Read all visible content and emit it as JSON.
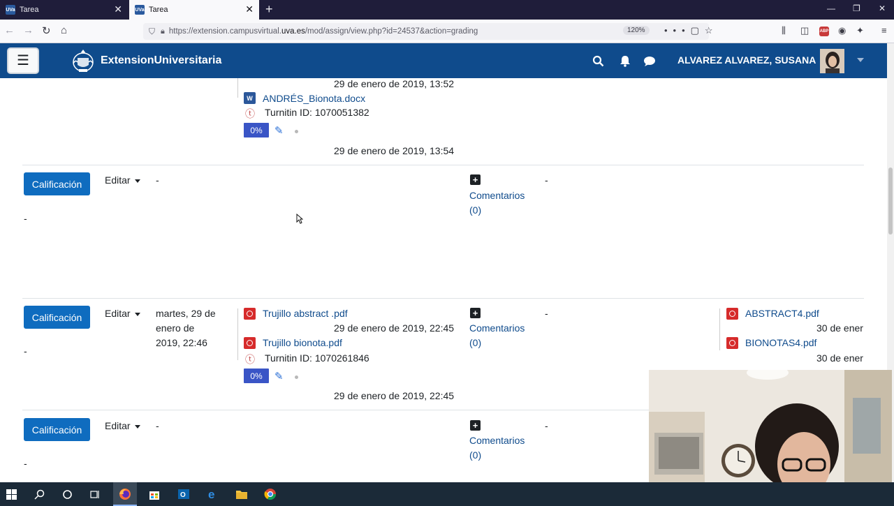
{
  "browser": {
    "tabs": [
      {
        "favicon": "UVa",
        "label": "Tarea",
        "close": "✕"
      },
      {
        "favicon": "UVa",
        "label": "Tarea",
        "close": "✕"
      }
    ],
    "new_tab": "+",
    "url_prefix": "https://extension.campusvirtual.",
    "url_domain": "uva.es",
    "url_suffix": "/mod/assign/view.php?id=24537&action=grading",
    "zoom": "120%",
    "abp_label": "ABP"
  },
  "moodle": {
    "brand": "ExtensionUniversitaria",
    "user": "ALVAREZ ALVAREZ, SUSANA",
    "theme_color": "#0f4b8c",
    "button_color": "#0f6cbf"
  },
  "rows": [
    {
      "files": [
        {
          "icon": "word-doc-icon",
          "name": "ANDRÉS_Bionota.docx"
        }
      ],
      "top_date": "29 de enero de 2019, 13:52",
      "turnitin": "Turnitin ID: 1070051382",
      "similarity": "0%",
      "bottom_date": "29 de enero de 2019, 13:54"
    },
    {
      "grade_button": "Calificación",
      "edit": "Editar",
      "modified": "-",
      "comments_label": "Comentarios",
      "comments_count": "(0)",
      "feedback": "-",
      "left_value": "-"
    },
    {
      "grade_button": "Calificación",
      "edit": "Editar",
      "modified": [
        "martes, 29 de",
        "enero de",
        "2019, 22:46"
      ],
      "files": [
        {
          "icon": "pdf-icon",
          "name": "Trujillo abstract .pdf",
          "date": "29 de enero de 2019, 22:45"
        },
        {
          "icon": "pdf-icon",
          "name": "Trujillo bionota.pdf"
        }
      ],
      "turnitin": "Turnitin ID: 1070261846",
      "similarity": "0%",
      "bottom_date": "29 de enero de 2019, 22:45",
      "comments_label": "Comentarios",
      "comments_count": "(0)",
      "feedback": "-",
      "left_value": "-",
      "feedback_files": [
        {
          "name": "ABSTRACT4.pdf",
          "date": "30 de ener"
        },
        {
          "name": "BIONOTAS4.pdf",
          "date": "30 de ener"
        }
      ]
    },
    {
      "grade_button": "Calificación",
      "edit": "Editar",
      "modified": "-",
      "comments_label": "Comentarios",
      "comments_count": "(0)",
      "feedback": "-",
      "left_value": "-"
    }
  ]
}
